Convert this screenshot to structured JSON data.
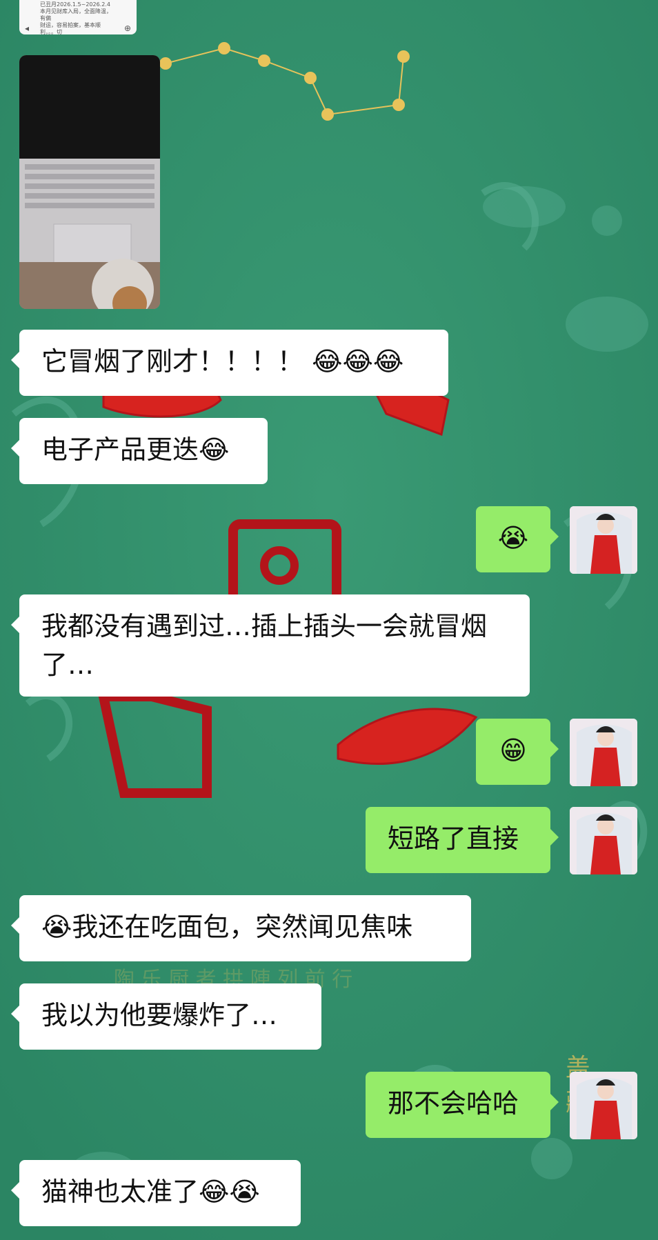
{
  "colors": {
    "background": "#2f8f6a",
    "incoming_bubble": "#ffffff",
    "outgoing_bubble": "#95ec69",
    "seal_red": "#d7231f",
    "gold": "#e8c35a"
  },
  "shared_card": {
    "line1": "已丑月2026.1.5~2026.2.4",
    "line2": "本月见财库入局，全面降温，有偏",
    "line3": "财运，容易拍案，基本顺利，。。切"
  },
  "messages": [
    {
      "side": "left",
      "type": "image",
      "icon": "laptop-photo"
    },
    {
      "side": "left",
      "type": "text",
      "text": "它冒烟了刚才！！！！",
      "emoji_after": [
        "tears-of-joy",
        "tears-of-joy",
        "tears-of-joy"
      ]
    },
    {
      "side": "left",
      "type": "text",
      "text": "电子产品更迭",
      "emoji_after": [
        "tears-of-joy"
      ]
    },
    {
      "side": "right",
      "type": "emoji",
      "emoji": [
        "loudly-crying"
      ]
    },
    {
      "side": "left",
      "type": "text",
      "text": "我都没有遇到过…插上插头一会就冒烟了…"
    },
    {
      "side": "right",
      "type": "emoji",
      "emoji": [
        "grinning"
      ]
    },
    {
      "side": "right",
      "type": "text",
      "text": "短路了直接"
    },
    {
      "side": "left",
      "type": "text",
      "text": "我还在吃面包，突然闻见焦味",
      "emoji_before": [
        "loudly-crying"
      ]
    },
    {
      "side": "left",
      "type": "text",
      "text": "我以为他要爆炸了…"
    },
    {
      "side": "right",
      "type": "text",
      "text": "那不会哈哈"
    },
    {
      "side": "left",
      "type": "text",
      "text": "猫神也太准了",
      "emoji_after": [
        "tears-of-joy",
        "loudly-crying"
      ]
    }
  ],
  "background_art": {
    "faint_text": "陶 乐 厨 者 拱 陣 列 前 行",
    "corner_text": "盖藏"
  }
}
